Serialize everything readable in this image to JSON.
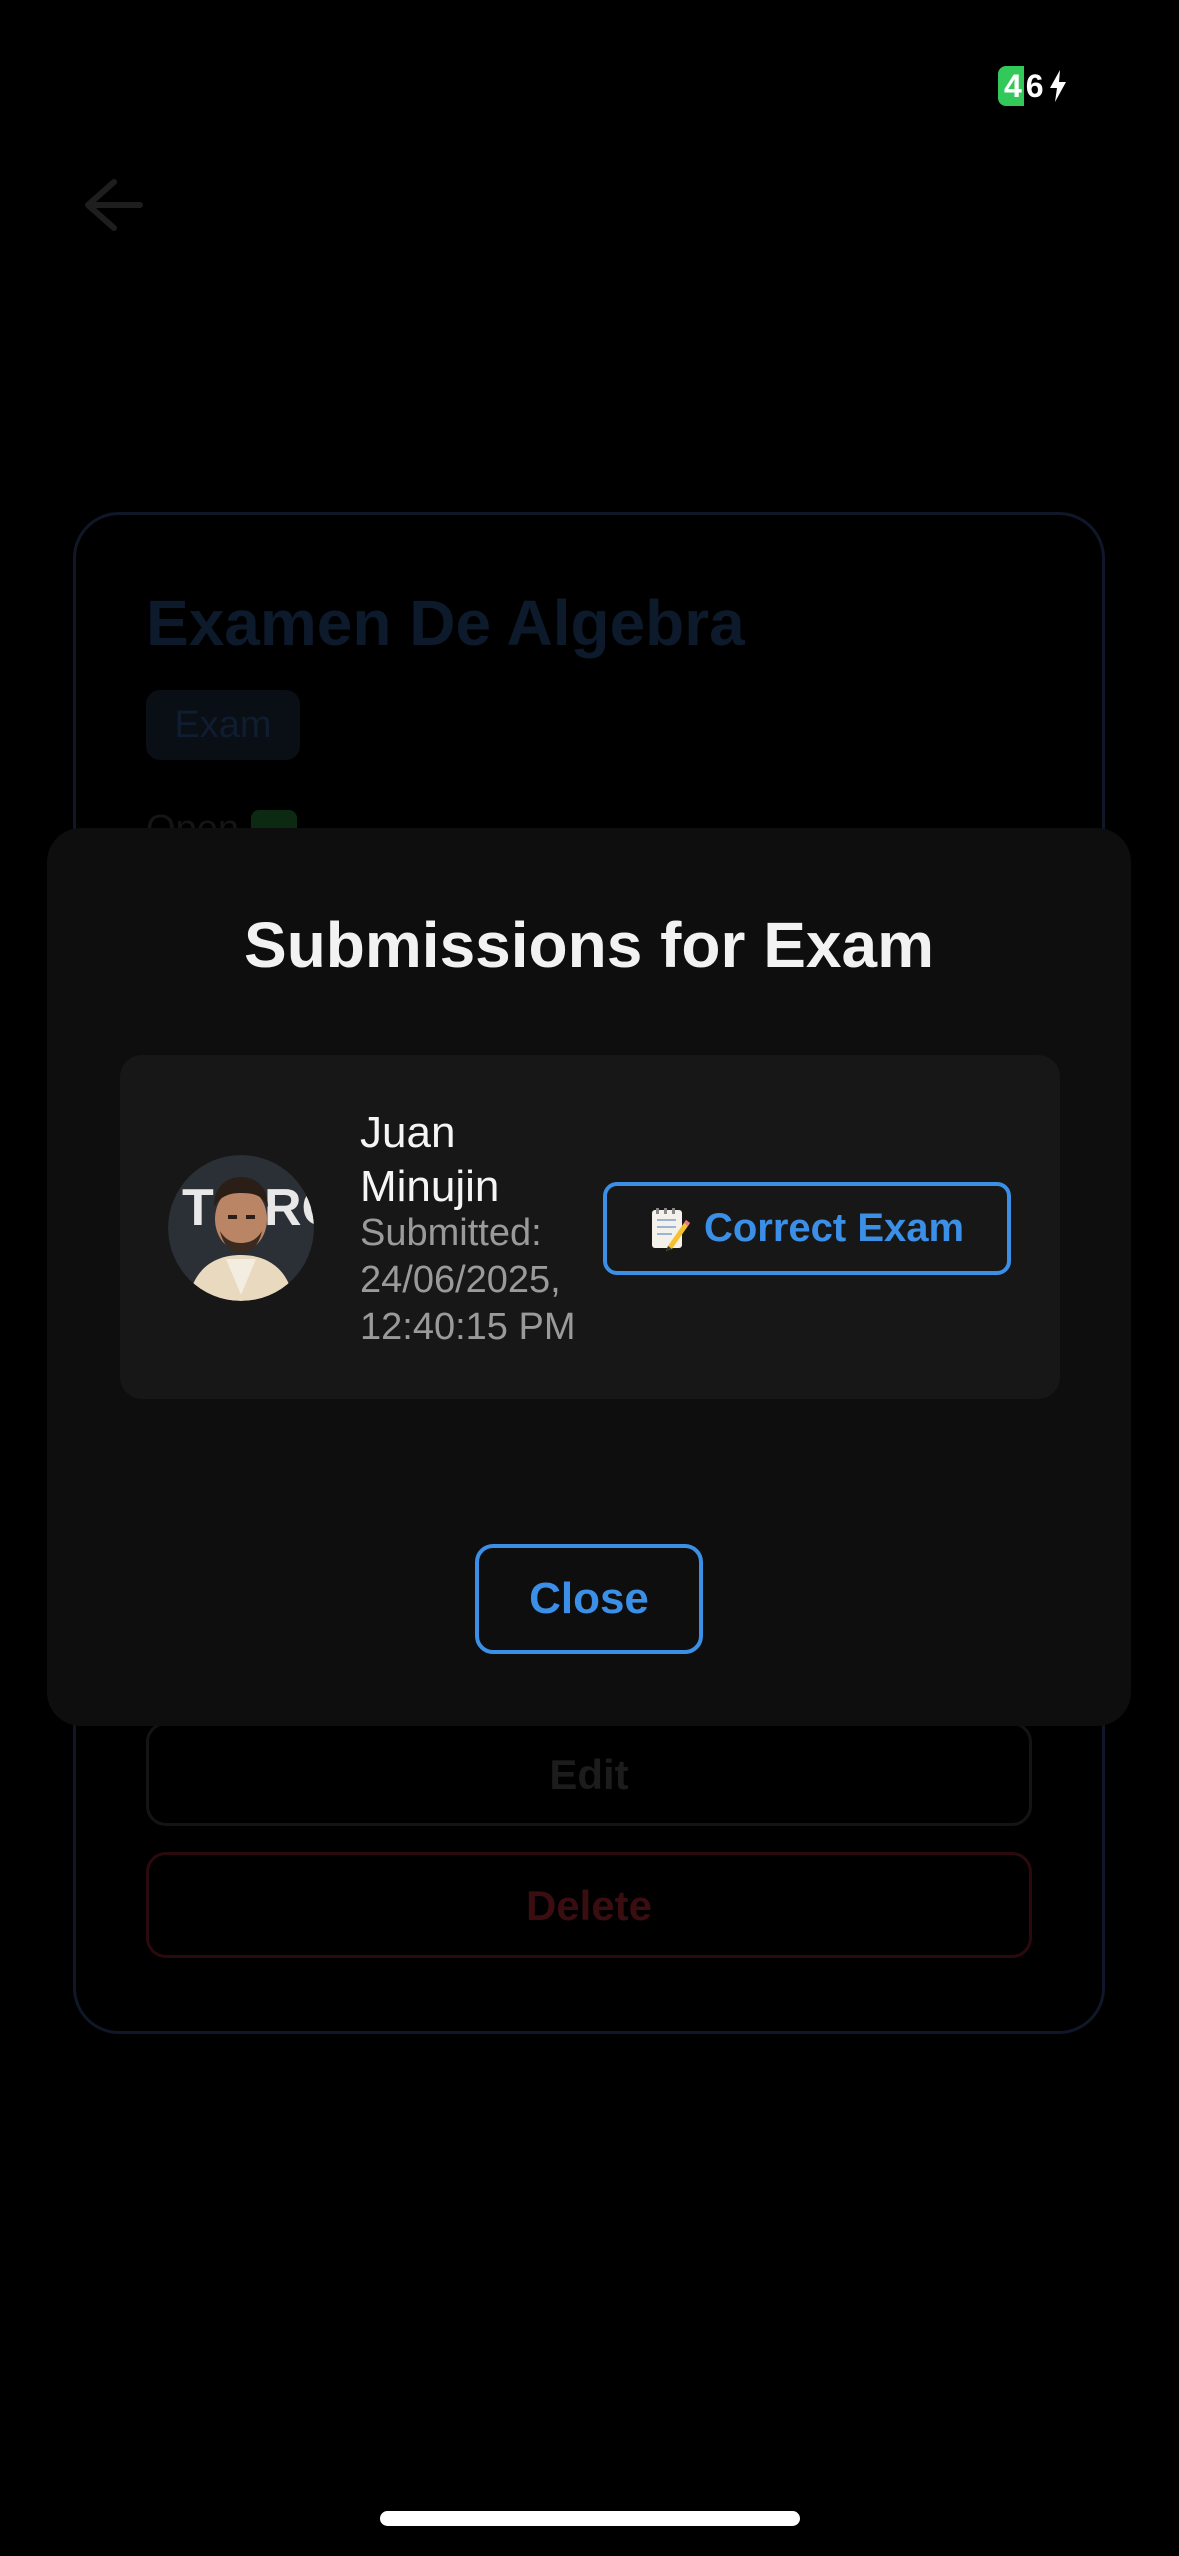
{
  "status_bar": {
    "battery_level": "46",
    "charging_icon": "bolt-icon"
  },
  "background": {
    "back_icon": "arrow-left-icon",
    "card_title": "Examen De Algebra",
    "type_chip": "Exam",
    "status_text": "Open",
    "status_icon": "check-icon",
    "edit_label": "Edit",
    "delete_label": "Delete"
  },
  "modal": {
    "title": "Submissions for Exam",
    "submissions": [
      {
        "student_name": "Juan Minujin",
        "submitted_text": "Submitted: 24/06/2025, 12:40:15 PM",
        "action_label": "Correct Exam",
        "action_icon": "memo-icon"
      }
    ],
    "close_label": "Close"
  },
  "colors": {
    "accent": "#3b8fe6",
    "modal_bg": "#0e0e0e",
    "card_bg": "#171717",
    "battery": "#32c85a"
  }
}
